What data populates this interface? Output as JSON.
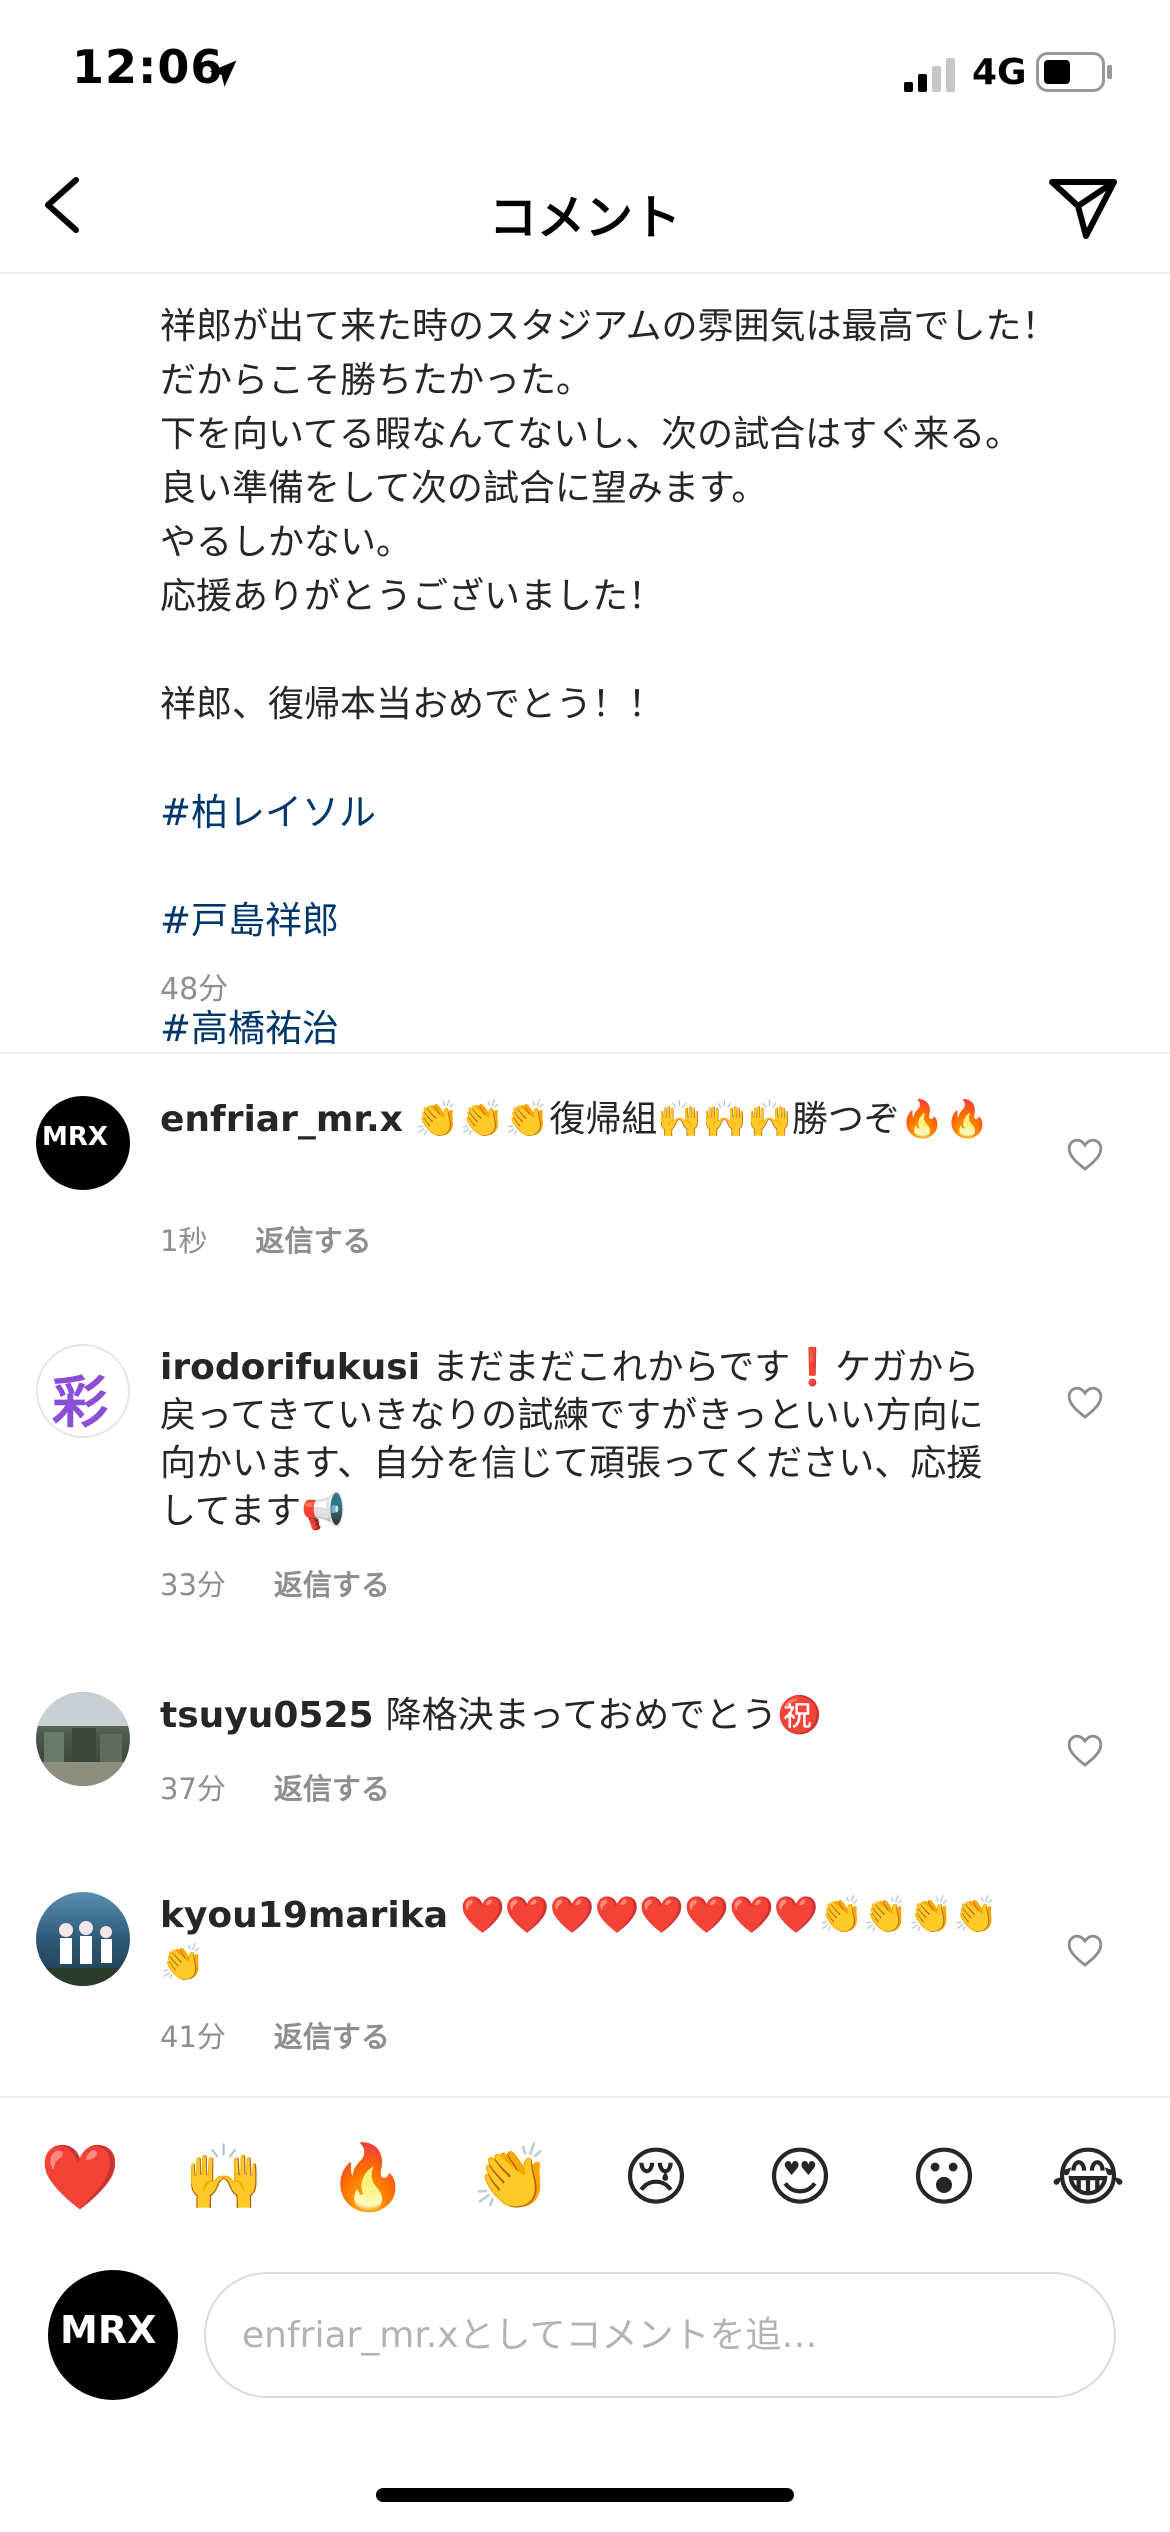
{
  "status_bar": {
    "time": "12:06",
    "network": "4G"
  },
  "header": {
    "title": "コメント"
  },
  "caption": {
    "text": "祥郎が出て来た時のスタジアムの雰囲気は最高でした！\nだからこそ勝ちたかった。\n下を向いてる暇なんてないし、次の試合はすぐ来る。\n良い準備をして次の試合に望みます。\nやるしかない。\n応援ありがとうございました！\n\n祥郎、復帰本当おめでとう！！\n",
    "hashtags": [
      "#柏レイソル",
      "#戸島祥郎",
      "#高橋祐治"
    ],
    "time": "48分"
  },
  "comments": [
    {
      "username": "enfriar_mr.x",
      "text": "👏👏👏復帰組🙌🙌🙌勝つぞ🔥🔥",
      "time": "1秒",
      "reply_label": "返信する",
      "avatar_text": "MRX"
    },
    {
      "username": "irodorifukusi",
      "text": "まだまだこれからです❗️ケガから戻ってきていきなりの試練ですがきっといい方向に向かいます、自分を信じて頑張ってください、応援してます📢",
      "time": "33分",
      "reply_label": "返信する",
      "avatar_text": "彩"
    },
    {
      "username": "tsuyu0525",
      "text": "降格決まっておめでとう㊗️",
      "time": "37分",
      "reply_label": "返信する"
    },
    {
      "username": "kyou19marika",
      "text": "❤️❤️❤️❤️❤️❤️❤️❤️👏👏👏👏👏",
      "time": "41分",
      "reply_label": "返信する"
    }
  ],
  "reactions": [
    "❤️",
    "🙌",
    "🔥",
    "👏",
    "😢",
    "😍",
    "😮",
    "😂"
  ],
  "input": {
    "placeholder": "enfriar_mr.xとしてコメントを追…",
    "avatar_text": "MRX"
  },
  "colors": {
    "hashtag": "#00376b",
    "secondary_text": "#8e8e8e",
    "divider": "#efefef"
  }
}
